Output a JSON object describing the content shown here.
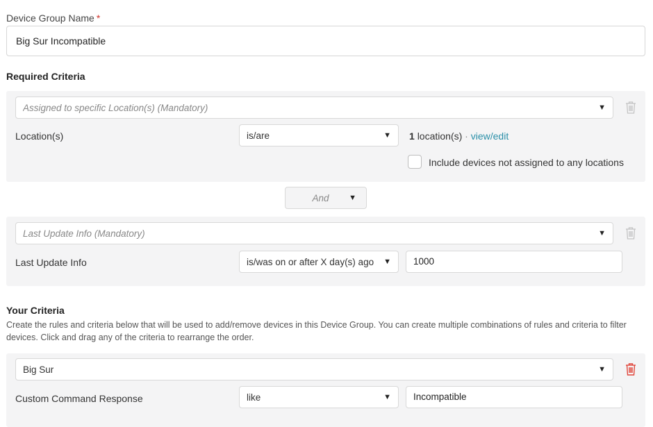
{
  "device_group": {
    "label": "Device Group Name",
    "required_star": "*",
    "value": "Big Sur Incompatible"
  },
  "required_criteria": {
    "title": "Required Criteria",
    "location_block": {
      "criteria_placeholder": "Assigned to specific Location(s) (Mandatory)",
      "row_label": "Location(s)",
      "operator": "is/are",
      "count": "1",
      "count_suffix": "location(s)",
      "separator": "·",
      "view_edit": "view/edit",
      "include_unassigned_label": "Include devices not assigned to any locations"
    },
    "conjunction": "And",
    "update_block": {
      "criteria_placeholder": "Last Update Info (Mandatory)",
      "row_label": "Last Update Info",
      "operator": "is/was on or after X day(s) ago",
      "value": "1000"
    }
  },
  "your_criteria": {
    "title": "Your Criteria",
    "description": "Create the rules and criteria below that will be used to add/remove devices in this Device Group. You can create multiple combinations of rules and criteria to filter devices. Click and drag any of the criteria to rearrange the order.",
    "block": {
      "criteria": "Big Sur",
      "row_label": "Custom Command Response",
      "operator": "like",
      "value": "Incompatible"
    }
  },
  "colors": {
    "accent_link": "#2a8fa8",
    "required_star": "#d0342c",
    "panel_bg": "#f4f4f5",
    "trash_active": "#e0453a",
    "trash_disabled": "#c4c4c4"
  },
  "icons": {
    "dropdown": "caret-down-icon",
    "delete": "trash-icon",
    "checkbox": "checkbox-unchecked"
  }
}
